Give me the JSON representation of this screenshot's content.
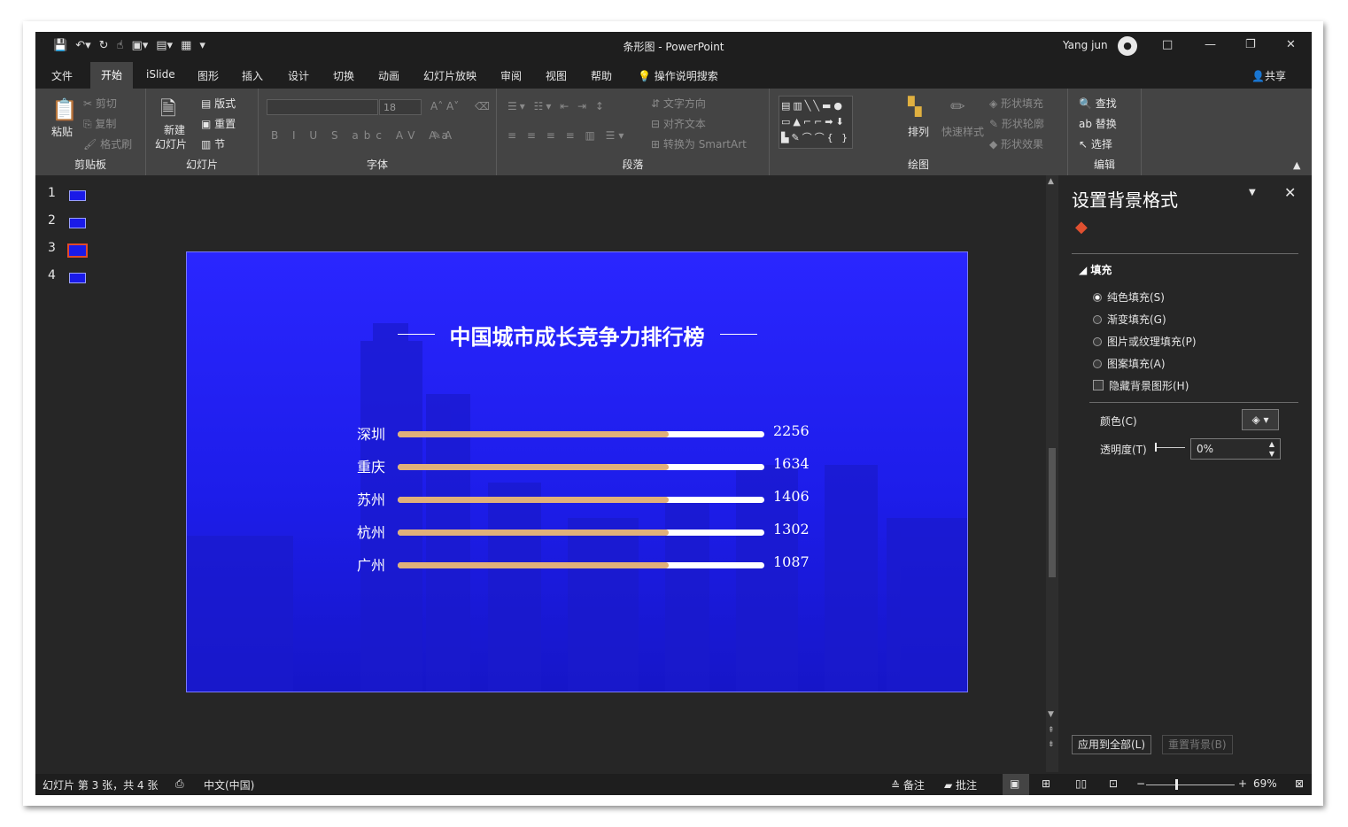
{
  "window": {
    "doc_title": "条形图  -  PowerPoint",
    "user_name": "Yang jun",
    "qat_icons": [
      "save-icon",
      "undo-icon",
      "redo-icon",
      "touch-mode-icon",
      "more-icon"
    ],
    "controls": [
      "□",
      "—",
      "❐",
      "✕"
    ]
  },
  "tabs": [
    "文件",
    "开始",
    "iSlide",
    "图形",
    "插入",
    "设计",
    "切换",
    "动画",
    "幻灯片放映",
    "审阅",
    "视图",
    "帮助"
  ],
  "active_tab": "开始",
  "tell_me": "操作说明搜索",
  "share": "共享",
  "ribbon": {
    "clipboard": {
      "paste": "粘贴",
      "cut": "剪切",
      "copy": "复制",
      "format_painter": "格式刷",
      "label": "剪贴板"
    },
    "slides": {
      "new_slide_1": "新建",
      "new_slide_2": "幻灯片",
      "layout": "版式",
      "reset": "重置",
      "section": "节",
      "label": "幻灯片"
    },
    "font": {
      "size": "18",
      "label": "字体"
    },
    "paragraph": {
      "text_direction": "文字方向",
      "align_text": "对齐文本",
      "smartart": "转换为 SmartArt",
      "label": "段落"
    },
    "drawing": {
      "arrange": "排列",
      "quick_styles": "快速样式",
      "shape_fill": "形状填充",
      "shape_outline": "形状轮廓",
      "shape_effects": "形状效果",
      "label": "绘图"
    },
    "editing": {
      "find": "查找",
      "replace": "替换",
      "select": "选择",
      "label": "编辑"
    }
  },
  "thumbnails": [
    "1",
    "2",
    "3",
    "4"
  ],
  "selected_slide": 3,
  "slide": {
    "title": "中国城市成长竞争力排行榜",
    "bars": [
      {
        "city": "深圳",
        "value": "2256",
        "fill": 0.74
      },
      {
        "city": "重庆",
        "value": "1634",
        "fill": 0.74
      },
      {
        "city": "苏州",
        "value": "1406",
        "fill": 0.74
      },
      {
        "city": "杭州",
        "value": "1302",
        "fill": 0.74
      },
      {
        "city": "广州",
        "value": "1087",
        "fill": 0.74
      }
    ],
    "colors": {
      "background": "#2020f0",
      "bar_track": "#ffffff",
      "bar_fill": "#e0b07a"
    }
  },
  "pane": {
    "title": "设置背景格式",
    "section": "填充",
    "options": [
      "纯色填充(S)",
      "渐变填充(G)",
      "图片或纹理填充(P)",
      "图案填充(A)"
    ],
    "selected_option": 0,
    "hide_bg": "隐藏背景图形(H)",
    "color_label": "颜色(C)",
    "transparency_label": "透明度(T)",
    "transparency_value": "0%",
    "apply_all": "应用到全部(L)",
    "reset_bg": "重置背景(B)"
  },
  "status": {
    "slide_info": "幻灯片 第 3 张，共 4 张",
    "language": "中文(中国)",
    "notes": "备注",
    "comments": "批注",
    "zoom": "69%"
  }
}
